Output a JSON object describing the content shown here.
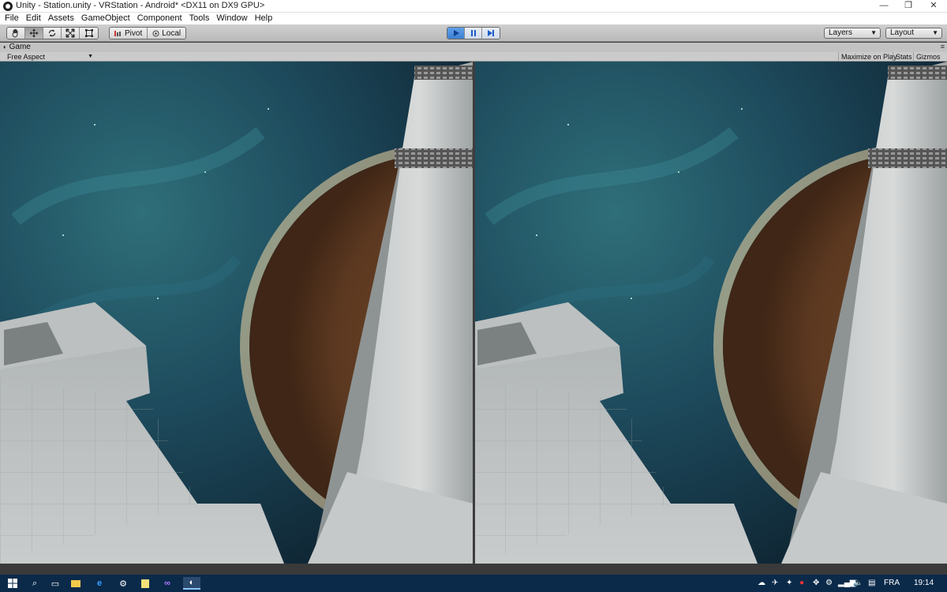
{
  "window": {
    "title": "Unity - Station.unity - VRStation - Android* <DX11 on DX9 GPU>",
    "minimize_glyph": "—",
    "maximize_glyph": "❐",
    "close_glyph": "✕"
  },
  "menu": [
    "File",
    "Edit",
    "Assets",
    "GameObject",
    "Component",
    "Tools",
    "Window",
    "Help"
  ],
  "toolbar": {
    "pivot_label": "Pivot",
    "local_label": "Local",
    "layers_label": "Layers",
    "layout_label": "Layout"
  },
  "game_panel": {
    "tab_label": "Game",
    "aspect_label": "Free Aspect",
    "maximize_label": "Maximize on Play",
    "stats_label": "Stats",
    "gizmos_label": "Gizmos"
  },
  "taskbar": {
    "language": "FRA",
    "time": "19:14"
  },
  "colors": {
    "play_active": "#3d7fd0",
    "taskbar_bg": "#0b2a4a",
    "space": "#1d3f52",
    "planet": "#6a4528",
    "planet_glow": "#f3d6a2",
    "station_light": "#cfd2d2"
  }
}
